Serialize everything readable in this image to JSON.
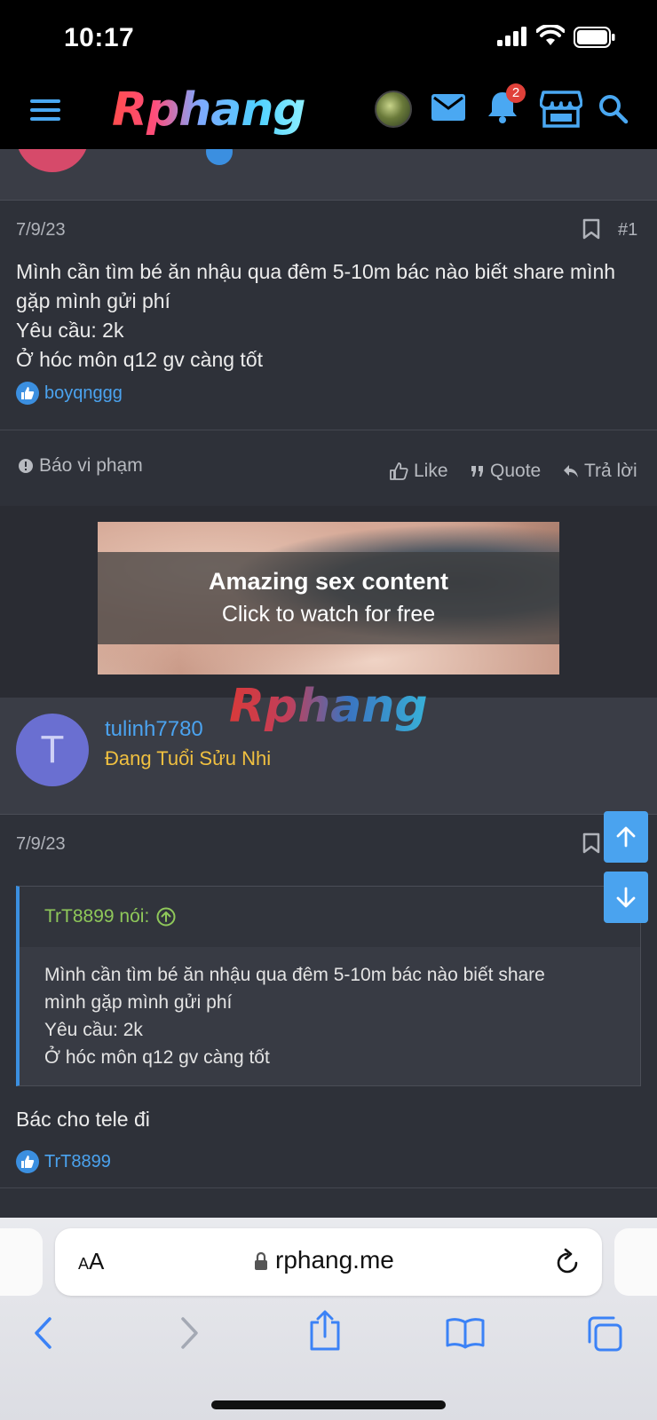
{
  "status_bar": {
    "time": "10:17"
  },
  "nav": {
    "logo": "Rphang",
    "notification_count": "2"
  },
  "post1": {
    "date": "7/9/23",
    "number": "#1",
    "lines": [
      "Mình cần tìm bé ăn nhậu qua đêm 5-10m bác nào biết share mình",
      "gặp mình gửi phí",
      "Yêu cầu: 2k",
      "Ở hóc môn q12 gv càng tốt"
    ],
    "reaction_user": "boyqnggg"
  },
  "actions": {
    "report": "Báo vi phạm",
    "like": "Like",
    "quote": "Quote",
    "reply": "Trả lời"
  },
  "ad": {
    "title": "Amazing sex content",
    "subtitle": "Click to watch for free"
  },
  "watermark": "Rphang",
  "post2": {
    "avatar_letter": "T",
    "username": "tulinh7780",
    "user_title": "Đang Tuổi Sửu Nhi",
    "date": "7/9/23",
    "quote_author": "TrT8899 nói:",
    "quote_lines": [
      "Mình cần tìm bé ăn nhậu qua đêm 5-10m bác nào biết share",
      "mình gặp mình gửi phí",
      "Yêu cầu: 2k",
      "Ở hóc môn q12 gv càng tốt"
    ],
    "reply_text": "Bác cho tele đi",
    "reaction_user": "TrT8899"
  },
  "safari": {
    "aa_label": "AA",
    "url": "rphang.me"
  },
  "colors": {
    "accent": "#4ba3ef",
    "background": "#2e3139",
    "user_title": "#f0c040",
    "quote_author": "#8fc85a"
  }
}
